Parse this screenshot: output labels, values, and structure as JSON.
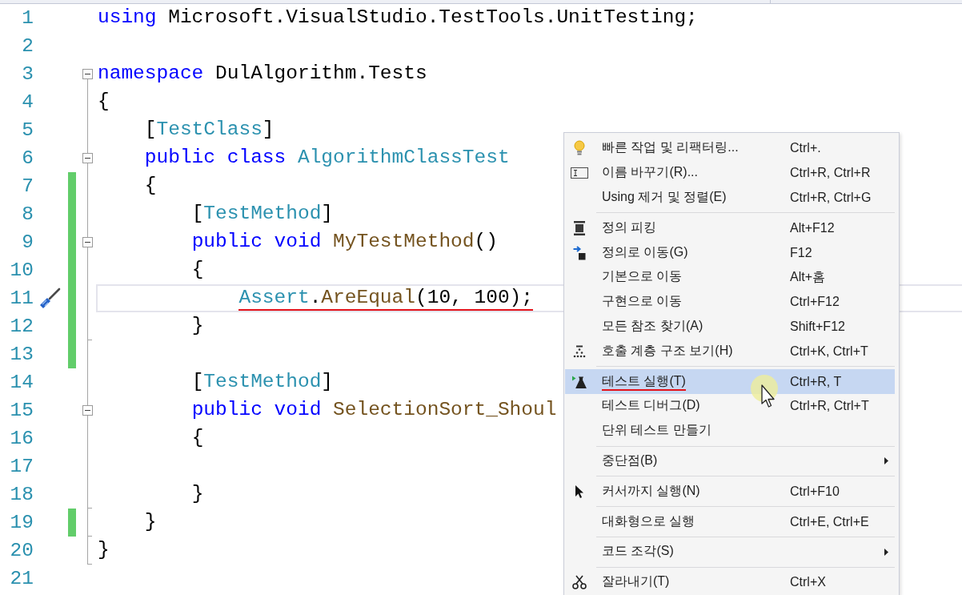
{
  "editor": {
    "lines": [
      {
        "number": "1",
        "kind": "plain",
        "code": [
          {
            "text": "using",
            "kind": "keyword"
          },
          {
            "text": " Microsoft.VisualStudio.TestTools.UnitTesting;",
            "kind": "plain"
          }
        ],
        "changed": false,
        "current": false,
        "quick_actions": false,
        "underlined": false
      },
      {
        "number": "2",
        "kind": "plain",
        "changed": false,
        "current": false,
        "quick_actions": false
      },
      {
        "number": "3",
        "kind": "fold_start",
        "code": [
          {
            "text": "namespace",
            "kind": "keyword"
          },
          {
            "text": " DulAlgorithm.Tests",
            "kind": "plain"
          }
        ],
        "changed": false,
        "current": false,
        "quick_actions": false,
        "underlined": false
      },
      {
        "number": "4",
        "kind": "fold_inside",
        "code": [
          {
            "text": "{",
            "kind": "plain"
          }
        ],
        "changed": false,
        "current": false,
        "quick_actions": false,
        "underlined": false
      },
      {
        "number": "5",
        "kind": "fold_inside",
        "code": [
          {
            "text": "    [",
            "kind": "plain"
          },
          {
            "text": "TestClass",
            "kind": "type"
          },
          {
            "text": "]",
            "kind": "plain"
          }
        ],
        "changed": false,
        "current": false,
        "quick_actions": false,
        "underlined": false
      },
      {
        "number": "6",
        "kind": "fold_start",
        "code": [
          {
            "text": "    public class ",
            "kind": "keyword"
          },
          {
            "text": "AlgorithmClassTest",
            "kind": "type"
          }
        ],
        "changed": false,
        "current": false,
        "quick_actions": false,
        "underlined": false
      },
      {
        "number": "7",
        "kind": "fold_inside",
        "code": [
          {
            "text": "    {",
            "kind": "plain"
          }
        ],
        "changed": true,
        "current": false,
        "quick_actions": false,
        "underlined": false
      },
      {
        "number": "8",
        "kind": "fold_inside",
        "code": [
          {
            "text": "        [",
            "kind": "plain"
          },
          {
            "text": "TestMethod",
            "kind": "type"
          },
          {
            "text": "]",
            "kind": "plain"
          }
        ],
        "changed": true,
        "current": false,
        "quick_actions": false,
        "underlined": false
      },
      {
        "number": "9",
        "kind": "fold_start",
        "code": [
          {
            "text": "        public void ",
            "kind": "keyword"
          },
          {
            "text": "MyTestMethod",
            "kind": "method"
          },
          {
            "text": "()",
            "kind": "plain"
          }
        ],
        "changed": true,
        "current": false,
        "quick_actions": false,
        "underlined": false
      },
      {
        "number": "10",
        "kind": "fold_inside",
        "code": [
          {
            "text": "        {",
            "kind": "plain"
          }
        ],
        "changed": true,
        "current": false,
        "quick_actions": false,
        "underlined": false
      },
      {
        "number": "11",
        "kind": "fold_inside",
        "code": [
          {
            "text": "            Assert",
            "kind": "type"
          },
          {
            "text": ".",
            "kind": "plain"
          },
          {
            "text": "AreEqual",
            "kind": "method"
          },
          {
            "text": "(10, 100);",
            "kind": "plain"
          }
        ],
        "changed": true,
        "current": true,
        "quick_actions": true,
        "underlined": true
      },
      {
        "number": "12",
        "kind": "fold_end",
        "code": [
          {
            "text": "        }",
            "kind": "plain"
          }
        ],
        "changed": true,
        "current": false,
        "quick_actions": false,
        "underlined": false
      },
      {
        "number": "13",
        "kind": "fold_inside",
        "changed": true,
        "current": false,
        "quick_actions": false
      },
      {
        "number": "14",
        "kind": "fold_inside",
        "code": [
          {
            "text": "        [",
            "kind": "plain"
          },
          {
            "text": "TestMethod",
            "kind": "type"
          },
          {
            "text": "]",
            "kind": "plain"
          }
        ],
        "changed": false,
        "current": false,
        "quick_actions": false,
        "underlined": false
      },
      {
        "number": "15",
        "kind": "fold_start",
        "code": [
          {
            "text": "        public void ",
            "kind": "keyword"
          },
          {
            "text": "SelectionSort_Shoul",
            "kind": "method"
          }
        ],
        "changed": false,
        "current": false,
        "quick_actions": false,
        "underlined": false
      },
      {
        "number": "16",
        "kind": "fold_inside",
        "code": [
          {
            "text": "        {",
            "kind": "plain"
          }
        ],
        "changed": false,
        "current": false,
        "quick_actions": false,
        "underlined": false
      },
      {
        "number": "17",
        "kind": "fold_inside",
        "changed": false,
        "current": false,
        "quick_actions": false
      },
      {
        "number": "18",
        "kind": "fold_end",
        "code": [
          {
            "text": "        }",
            "kind": "plain"
          }
        ],
        "changed": false,
        "current": false,
        "quick_actions": false,
        "underlined": false
      },
      {
        "number": "19",
        "kind": "fold_end",
        "code": [
          {
            "text": "    }",
            "kind": "plain"
          }
        ],
        "changed": true,
        "current": false,
        "quick_actions": false,
        "underlined": false
      },
      {
        "number": "20",
        "kind": "fold_end",
        "code": [
          {
            "text": "}",
            "kind": "plain"
          }
        ],
        "changed": false,
        "current": false,
        "quick_actions": false,
        "underlined": false
      },
      {
        "number": "21",
        "kind": "plain",
        "changed": false,
        "current": false,
        "quick_actions": false
      }
    ]
  },
  "context_menu": {
    "groups": [
      {
        "items": [
          {
            "label": "빠른 작업 및 리팩터링...",
            "shortcut": "Ctrl+.",
            "submenu": false,
            "selected": false,
            "underlined": false
          },
          {
            "label": "이름 바꾸기(R)...",
            "shortcut": "Ctrl+R, Ctrl+R",
            "submenu": false,
            "selected": false,
            "underlined": false
          },
          {
            "label": "Using 제거 및 정렬(E)",
            "shortcut": "Ctrl+R, Ctrl+G",
            "submenu": false,
            "selected": false,
            "underlined": false
          }
        ]
      },
      {
        "items": [
          {
            "label": "정의 피킹",
            "shortcut": "Alt+F12",
            "submenu": false,
            "selected": false,
            "underlined": false
          },
          {
            "label": "정의로 이동(G)",
            "shortcut": "F12",
            "submenu": false,
            "selected": false,
            "underlined": false
          },
          {
            "label": "기본으로 이동",
            "shortcut": "Alt+홈",
            "submenu": false,
            "selected": false,
            "underlined": false
          },
          {
            "label": "구현으로 이동",
            "shortcut": "Ctrl+F12",
            "submenu": false,
            "selected": false,
            "underlined": false
          },
          {
            "label": "모든 참조 찾기(A)",
            "shortcut": "Shift+F12",
            "submenu": false,
            "selected": false,
            "underlined": false
          },
          {
            "label": "호출 계층 구조 보기(H)",
            "shortcut": "Ctrl+K, Ctrl+T",
            "submenu": false,
            "selected": false,
            "underlined": false
          }
        ]
      },
      {
        "items": [
          {
            "label": "테스트 실행(T)",
            "shortcut": "Ctrl+R, T",
            "submenu": false,
            "selected": true,
            "underlined": true
          },
          {
            "label": "테스트 디버그(D)",
            "shortcut": "Ctrl+R, Ctrl+T",
            "submenu": false,
            "selected": false,
            "underlined": false
          },
          {
            "label": "단위 테스트 만들기",
            "submenu": false,
            "selected": false,
            "underlined": false
          }
        ]
      },
      {
        "items": [
          {
            "label": "중단점(B)",
            "submenu": true,
            "selected": false,
            "underlined": false
          }
        ]
      },
      {
        "items": [
          {
            "label": "커서까지 실행(N)",
            "shortcut": "Ctrl+F10",
            "submenu": false,
            "selected": false,
            "underlined": false
          }
        ]
      },
      {
        "items": [
          {
            "label": "대화형으로 실행",
            "shortcut": "Ctrl+E, Ctrl+E",
            "submenu": false,
            "selected": false,
            "underlined": false
          }
        ]
      },
      {
        "items": [
          {
            "label": "코드 조각(S)",
            "submenu": true,
            "selected": false,
            "underlined": false
          }
        ]
      },
      {
        "items": [
          {
            "label": "잘라내기(T)",
            "shortcut": "Ctrl+X",
            "submenu": false,
            "selected": false,
            "underlined": false
          }
        ]
      }
    ]
  }
}
